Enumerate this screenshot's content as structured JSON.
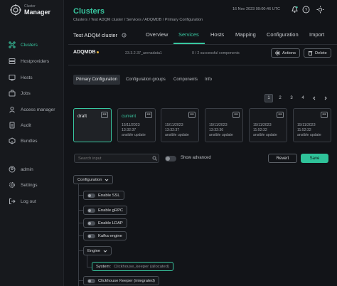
{
  "sidebar": {
    "logo_small": "Cluster",
    "logo_big": "Manager",
    "items": [
      {
        "label": "Clusters"
      },
      {
        "label": "Hostproviders"
      },
      {
        "label": "Hosts"
      },
      {
        "label": "Jobs"
      },
      {
        "label": "Access manager"
      },
      {
        "label": "Audit"
      },
      {
        "label": "Bundles"
      }
    ],
    "bottom": [
      {
        "label": "admin"
      },
      {
        "label": "Settings"
      },
      {
        "label": "Log out"
      }
    ]
  },
  "header": {
    "title": "Clusters",
    "breadcrumbs": "Clusters / Test ADQM cluster / Services / ADQMDB / Primary Configuration",
    "datetime": "16 Nov 2023  09:00:46  UTC"
  },
  "cluster": {
    "name": "Test ADQM cluster",
    "tabs": [
      "Overview",
      "Services",
      "Hosts",
      "Mapping",
      "Configuration",
      "Import"
    ],
    "active_tab": "Services"
  },
  "component": {
    "name": "ADQMDB",
    "version": "23.3.2.37_arenadata1",
    "status": "0 / 2 successful components",
    "actions_label": "Actions",
    "delete_label": "Delete"
  },
  "subtabs": [
    "Primary Configuration",
    "Configuration groups",
    "Components",
    "Info"
  ],
  "pager": [
    "1",
    "2",
    "3",
    "4"
  ],
  "configs": [
    {
      "label": "draft",
      "date": "",
      "time": "",
      "desc": ""
    },
    {
      "label": "current",
      "date": "15/11/2023",
      "time": "13:32:37",
      "desc": "ansible update"
    },
    {
      "label": "",
      "date": "15/11/2023",
      "time": "13:32:37",
      "desc": "ansible update"
    },
    {
      "label": "",
      "date": "15/11/2023",
      "time": "13:32:36",
      "desc": "ansible update"
    },
    {
      "label": "",
      "date": "15/11/2023",
      "time": "11:52:32",
      "desc": "ansible update"
    },
    {
      "label": "",
      "date": "15/11/2023",
      "time": "11:52:32",
      "desc": "ansible update"
    }
  ],
  "toolbar": {
    "search_placeholder": "Search input",
    "show_advanced": "Show advanced",
    "revert": "Revert",
    "save": "Save"
  },
  "tree": {
    "root": "Configuration",
    "items": [
      "Enable SSL",
      "Enable gRPC",
      "Enable LDAP",
      "Kafka engine"
    ],
    "engine": "Engine",
    "system_label": "System:",
    "system_value": "Clickhouse_keeper (allocated)",
    "last": "Clickhouse Keeper (integrated)"
  },
  "colors": {
    "accent": "#38c7a0",
    "background": "#121418",
    "sidebar": "#17191d",
    "warning_dot": "#e3b341"
  }
}
